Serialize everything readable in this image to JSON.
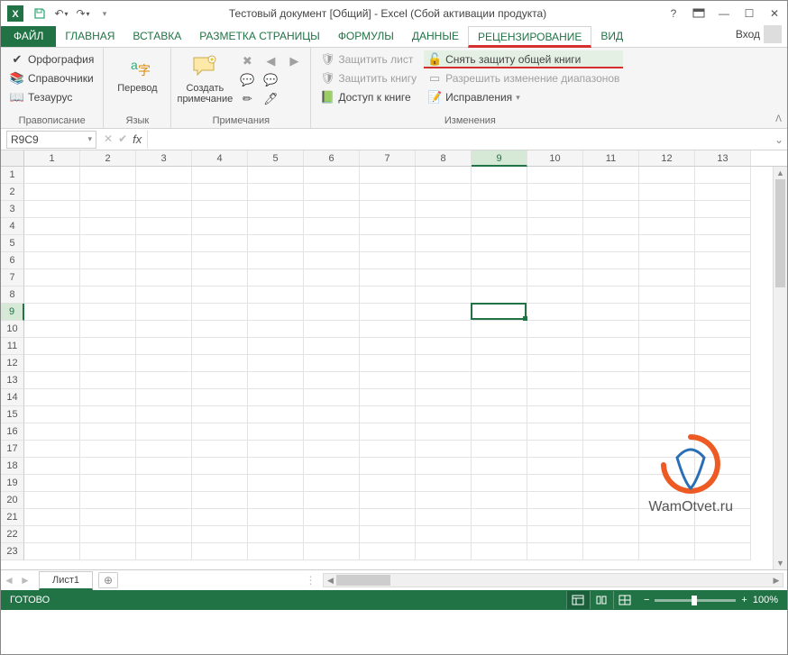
{
  "title": "Тестовый документ  [Общий] - Excel (Сбой активации продукта)",
  "qat": {
    "save": "💾",
    "undo": "↶",
    "redo": "↷"
  },
  "win": {
    "help": "?",
    "opts": "▭",
    "min": "—",
    "max": "☐",
    "close": "✕"
  },
  "tabs": {
    "file": "ФАЙЛ",
    "home": "ГЛАВНАЯ",
    "insert": "ВСТАВКА",
    "layout": "РАЗМЕТКА СТРАНИЦЫ",
    "formulas": "ФОРМУЛЫ",
    "data": "ДАННЫЕ",
    "review": "РЕЦЕНЗИРОВАНИЕ",
    "view": "ВИД",
    "signin": "Вход"
  },
  "ribbon": {
    "proofing": {
      "label": "Правописание",
      "spelling": "Орфография",
      "research": "Справочники",
      "thesaurus": "Тезаурус"
    },
    "language": {
      "label": "Язык",
      "translate": "Перевод"
    },
    "comments": {
      "label": "Примечания",
      "new": "Создать",
      "new2": "примечание"
    },
    "changes": {
      "label": "Изменения",
      "protect_sheet": "Защитить лист",
      "protect_book": "Защитить книгу",
      "share": "Доступ к книге",
      "unprotect_shared": "Снять защиту общей книги",
      "allow_ranges": "Разрешить изменение диапазонов",
      "track": "Исправления"
    }
  },
  "namebox": "R9C9",
  "columns": [
    "1",
    "2",
    "3",
    "4",
    "5",
    "6",
    "7",
    "8",
    "9",
    "10",
    "11",
    "12",
    "13"
  ],
  "rows": [
    "1",
    "2",
    "3",
    "4",
    "5",
    "6",
    "7",
    "8",
    "9",
    "10",
    "11",
    "12",
    "13",
    "14",
    "15",
    "16",
    "17",
    "18",
    "19",
    "20",
    "21",
    "22",
    "23"
  ],
  "selected_col": 8,
  "selected_row": 8,
  "sheet_tab": "Лист1",
  "status_ready": "ГОТОВО",
  "zoom_pct": "100%",
  "watermark": "WamOtvet.ru"
}
